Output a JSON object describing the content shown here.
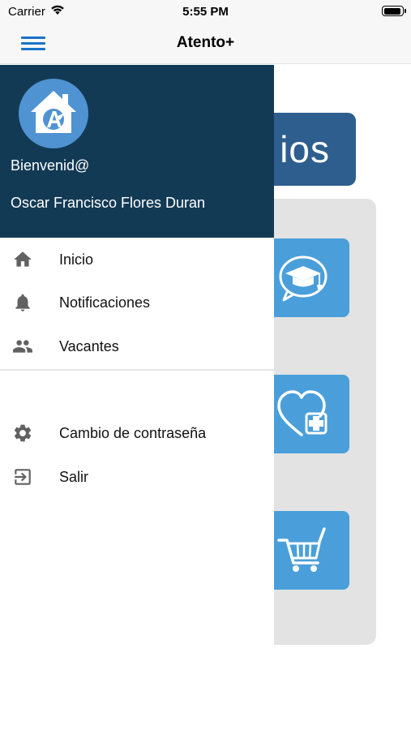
{
  "status_bar": {
    "carrier": "Carrier",
    "time": "5:55 PM"
  },
  "nav": {
    "title": "Atento+"
  },
  "background": {
    "banner_text": "ios"
  },
  "drawer": {
    "welcome": "Bienvenid@",
    "user_name": "Oscar Francisco Flores Duran",
    "menu_primary": [
      {
        "label": "Inicio",
        "icon": "home-icon"
      },
      {
        "label": "Notificaciones",
        "icon": "bell-icon"
      },
      {
        "label": "Vacantes",
        "icon": "people-icon"
      }
    ],
    "menu_secondary": [
      {
        "label": "Cambio de contraseña",
        "icon": "gear-icon"
      },
      {
        "label": "Salir",
        "icon": "exit-icon"
      }
    ]
  },
  "colors": {
    "drawer_header": "#133a55",
    "accent_blue": "#1a73c8",
    "card_blue": "#4a9fda",
    "banner_blue": "#2e5e8e"
  }
}
